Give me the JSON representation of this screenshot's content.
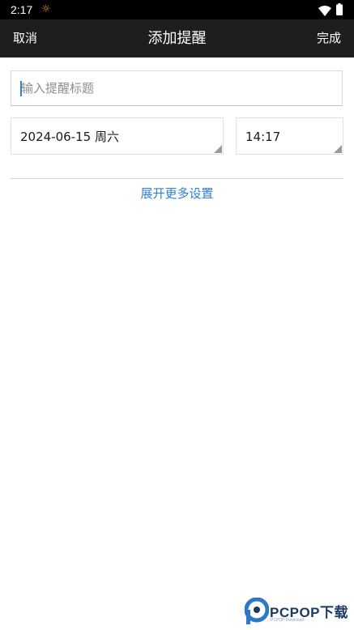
{
  "status_bar": {
    "time": "2:17",
    "sun_icon": "☼",
    "icons": [
      "sun-icon",
      "wifi-icon",
      "battery-icon"
    ]
  },
  "app_bar": {
    "cancel_label": "取消",
    "title": "添加提醒",
    "done_label": "完成"
  },
  "form": {
    "title_placeholder": "输入提醒标题",
    "title_value": "",
    "date_value": "2024-06-15 周六",
    "time_value": "14:17",
    "expand_label": "展开更多设置"
  },
  "watermark": {
    "brand": "PCPOP下载",
    "tagline": "PCPOP Download"
  },
  "colors": {
    "app_bar_bg": "#1e1e1e",
    "status_bar_bg": "#000000",
    "link": "#2f7fcf",
    "cursor": "#2e7fd8"
  }
}
